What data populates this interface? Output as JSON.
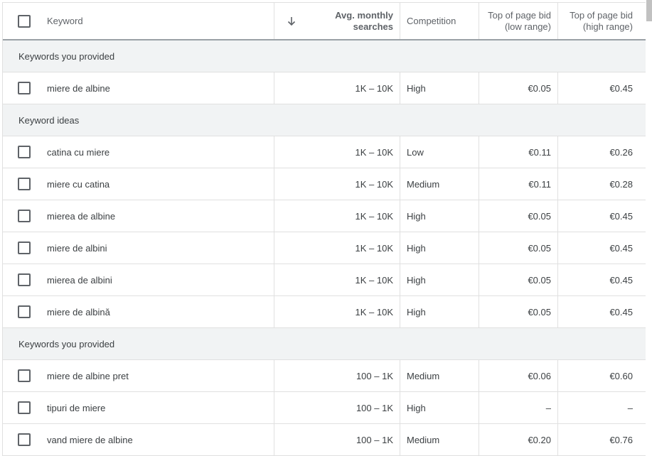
{
  "header": {
    "keyword": "Keyword",
    "sort_icon": "arrow-down-icon",
    "avg_line1": "Avg. monthly",
    "avg_line2": "searches",
    "competition": "Competition",
    "low_line1": "Top of page bid",
    "low_line2": "(low range)",
    "high_line1": "Top of page bid",
    "high_line2": "(high range)"
  },
  "groups": [
    {
      "label": "Keywords you provided",
      "rows": [
        {
          "keyword": "miere de albine",
          "avg": "1K – 10K",
          "competition": "High",
          "low": "€0.05",
          "high": "€0.45"
        }
      ]
    },
    {
      "label": "Keyword ideas",
      "rows": [
        {
          "keyword": "catina cu miere",
          "avg": "1K – 10K",
          "competition": "Low",
          "low": "€0.11",
          "high": "€0.26"
        },
        {
          "keyword": "miere cu catina",
          "avg": "1K – 10K",
          "competition": "Medium",
          "low": "€0.11",
          "high": "€0.28"
        },
        {
          "keyword": "mierea de albine",
          "avg": "1K – 10K",
          "competition": "High",
          "low": "€0.05",
          "high": "€0.45"
        },
        {
          "keyword": "miere de albini",
          "avg": "1K – 10K",
          "competition": "High",
          "low": "€0.05",
          "high": "€0.45"
        },
        {
          "keyword": "mierea de albini",
          "avg": "1K – 10K",
          "competition": "High",
          "low": "€0.05",
          "high": "€0.45"
        },
        {
          "keyword": "miere de albină",
          "avg": "1K – 10K",
          "competition": "High",
          "low": "€0.05",
          "high": "€0.45"
        }
      ]
    },
    {
      "label": "Keywords you provided",
      "rows": [
        {
          "keyword": "miere de albine pret",
          "avg": "100 – 1K",
          "competition": "Medium",
          "low": "€0.06",
          "high": "€0.60"
        },
        {
          "keyword": "tipuri de miere",
          "avg": "100 – 1K",
          "competition": "High",
          "low": "–",
          "high": "–"
        },
        {
          "keyword": "vand miere de albine",
          "avg": "100 – 1K",
          "competition": "Medium",
          "low": "€0.20",
          "high": "€0.76"
        }
      ]
    }
  ]
}
